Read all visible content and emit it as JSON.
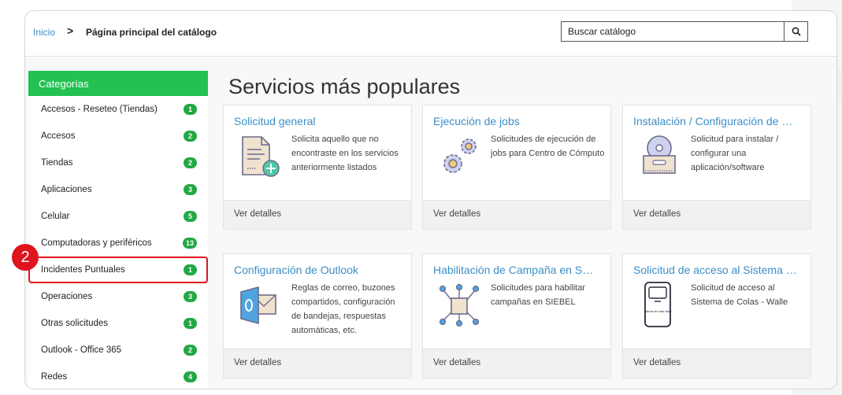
{
  "breadcrumb": {
    "home": "Inicio",
    "separator": ">",
    "current": "Página principal del catálogo"
  },
  "search": {
    "placeholder": "Buscar catálogo",
    "icon": "search-icon"
  },
  "sidebar": {
    "title": "Categorías",
    "items": [
      {
        "label": "Accesos - Reseteo (Tiendas)",
        "count": "1"
      },
      {
        "label": "Accesos",
        "count": "2"
      },
      {
        "label": "Tiendas",
        "count": "2"
      },
      {
        "label": "Aplicaciones",
        "count": "3"
      },
      {
        "label": "Celular",
        "count": "5"
      },
      {
        "label": "Computadoras y periféricos",
        "count": "13"
      },
      {
        "label": "Incidentes Puntuales",
        "count": "1"
      },
      {
        "label": "Operaciones",
        "count": "3"
      },
      {
        "label": "Otras solicitudes",
        "count": "1"
      },
      {
        "label": "Outlook - Office 365",
        "count": "2"
      },
      {
        "label": "Redes",
        "count": "4"
      }
    ]
  },
  "marker": "2",
  "main": {
    "title": "Servicios más populares",
    "cards": [
      {
        "title": "Solicitud general",
        "desc": "Solicita aquello que no encontraste en los servicios anteriormente listados",
        "foot": "Ver detalles",
        "icon": "document-add-icon"
      },
      {
        "title": "Ejecución de jobs",
        "desc": "Solicitudes de ejecución de jobs para Centro de Cómputo",
        "foot": "Ver detalles",
        "icon": "gears-icon"
      },
      {
        "title": "Instalación / Configuración de …",
        "desc": "Solicitud para instalar / configurar una aplicación/software",
        "foot": "Ver detalles",
        "icon": "software-box-icon"
      },
      {
        "title": "Configuración de Outlook",
        "desc": "Reglas de correo, buzones compartidos, configuración de bandejas, respuestas automáticas, etc.",
        "foot": "Ver detalles",
        "icon": "outlook-icon"
      },
      {
        "title": "Habilitación de Campaña en S…",
        "desc": "Solicitudes para habilitar campañas en SIEBEL",
        "foot": "Ver detalles",
        "icon": "network-box-icon"
      },
      {
        "title": "Solicitud de acceso al Sistema …",
        "desc": "Solicitud de acceso al Sistema de Colas - Walle",
        "foot": "Ver detalles",
        "icon": "kiosk-icon",
        "icon_text": "Sistema de colas Walle"
      }
    ]
  },
  "colors": {
    "accent": "#22c152",
    "badge": "#22a845",
    "link": "#3b8ec7",
    "highlight": "#e0141e"
  }
}
